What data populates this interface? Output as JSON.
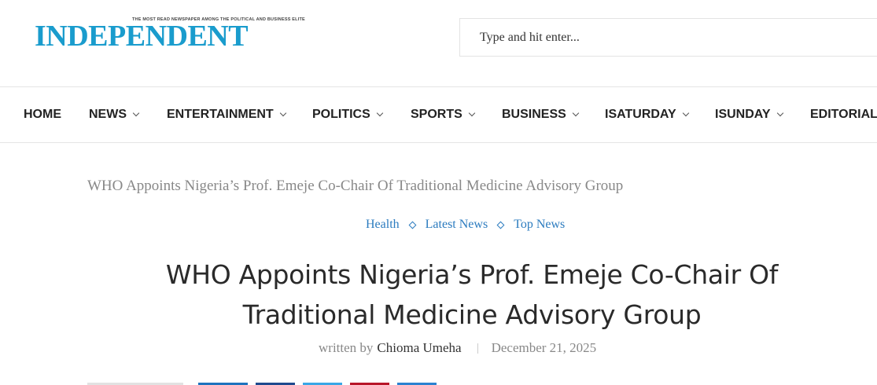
{
  "header": {
    "logo": {
      "tagline": "THE MOST READ NEWSPAPER AMONG THE POLITICAL AND BUSINESS ELITE",
      "name": "INDEPENDENT",
      "color": "#1a9ccd"
    },
    "search": {
      "placeholder": "Type and hit enter..."
    }
  },
  "nav": {
    "items": [
      {
        "label": "HOME",
        "dropdown": false
      },
      {
        "label": "NEWS",
        "dropdown": true
      },
      {
        "label": "ENTERTAINMENT",
        "dropdown": true
      },
      {
        "label": "POLITICS",
        "dropdown": true
      },
      {
        "label": "SPORTS",
        "dropdown": true
      },
      {
        "label": "BUSINESS",
        "dropdown": true
      },
      {
        "label": "ISATURDAY",
        "dropdown": true
      },
      {
        "label": "ISUNDAY",
        "dropdown": true
      },
      {
        "label": "EDITORIAL",
        "dropdown": false
      }
    ]
  },
  "breadcrumb": {
    "current": "WHO Appoints Nigeria’s Prof.  Emeje Co-Chair Of Traditional Medicine Advisory Group"
  },
  "article": {
    "categories": [
      "Health",
      "Latest News",
      "Top News"
    ],
    "title": "WHO Appoints Nigeria’s Prof.  Emeje Co-Chair Of Traditional Medicine Advisory Group",
    "written_by": "written by",
    "author": "Chioma Umeha",
    "date": "December 21, 2025"
  },
  "colors": {
    "accent": "#2b7bbf",
    "share_facebook": "#1e73be",
    "share_twitter": "#1f4a8e",
    "share_x": "#3aa7e6",
    "share_pinterest": "#b8172a",
    "share_linkedin": "#2b82d1"
  }
}
